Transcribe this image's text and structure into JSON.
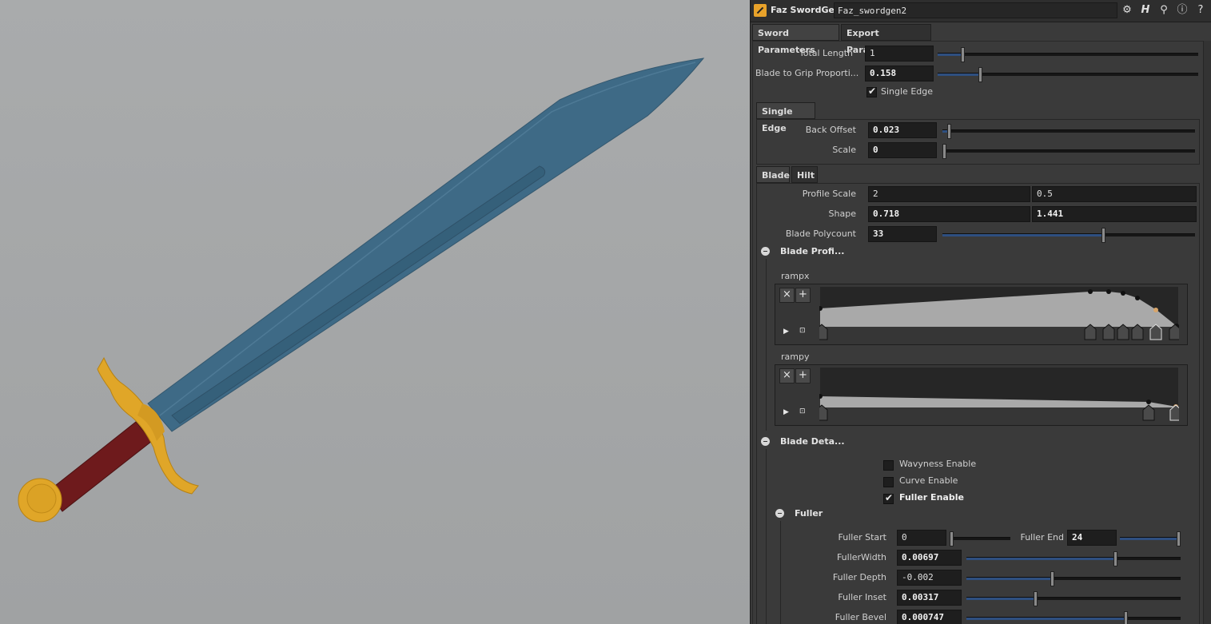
{
  "header": {
    "node_type": "Faz SwordGen",
    "node_name": "Faz_swordgen2",
    "icons": [
      "gear-icon",
      "houdini-help-icon",
      "search-icon",
      "info-icon",
      "help-icon"
    ]
  },
  "tabs_main": [
    {
      "label": "Sword Parameters",
      "active": true
    },
    {
      "label": "Export Parameters",
      "active": false
    }
  ],
  "params": {
    "total_length": {
      "label": "Total Length",
      "value": "1",
      "level": 0.09
    },
    "blade_grip": {
      "label": "Blade to Grip Proporti...",
      "value": "0.158",
      "level": 0.158
    },
    "single_edge": {
      "label": "Single Edge",
      "checked": true
    }
  },
  "single_edge_tab": {
    "label": "Single Edge",
    "back_offset": {
      "label": "Back Offset",
      "value": "0.023",
      "level": 0.02
    },
    "scale": {
      "label": "Scale",
      "value": "0",
      "level": 0
    }
  },
  "tabs_blade": [
    {
      "label": "Blade",
      "active": true
    },
    {
      "label": "Hilt",
      "active": false
    }
  ],
  "blade": {
    "profile_scale": {
      "label": "Profile Scale",
      "v1": "2",
      "v2": "0.5"
    },
    "shape": {
      "label": "Shape",
      "v1": "0.718",
      "v2": "1.441"
    },
    "polycount": {
      "label": "Blade Polycount",
      "value": "33",
      "level": 0.64
    },
    "profile_folder": "Blade Profi...",
    "rampx_label": "rampx",
    "rampy_label": "rampy",
    "details_folder": "Blade Deta...",
    "wavyness": {
      "label": "Wavyness Enable",
      "checked": false
    },
    "curve": {
      "label": "Curve Enable",
      "checked": false
    },
    "fuller_enable": {
      "label": "Fuller Enable",
      "checked": true
    },
    "fuller_folder": "Fuller",
    "fuller_start": {
      "label": "Fuller Start",
      "value": "0",
      "level": 0
    },
    "fuller_end": {
      "label": "Fuller End",
      "value": "24",
      "level": 1.0
    },
    "fuller_width": {
      "label": "FullerWidth",
      "value": "0.00697",
      "level": 0.7
    },
    "fuller_depth": {
      "label": "Fuller Depth",
      "value": "-0.002",
      "level": 0.4
    },
    "fuller_inset": {
      "label": "Fuller Inset",
      "value": "0.00317",
      "level": 0.32
    },
    "fuller_bevel": {
      "label": "Fuller Bevel",
      "value": "0.000747",
      "level": 0.75
    }
  },
  "colors": {
    "blade": "#3e6a86",
    "guard": "#e0a628",
    "grip": "#6e1a1c",
    "slider_fill": "#2e4f80",
    "node_icon": "#e8a22a"
  }
}
